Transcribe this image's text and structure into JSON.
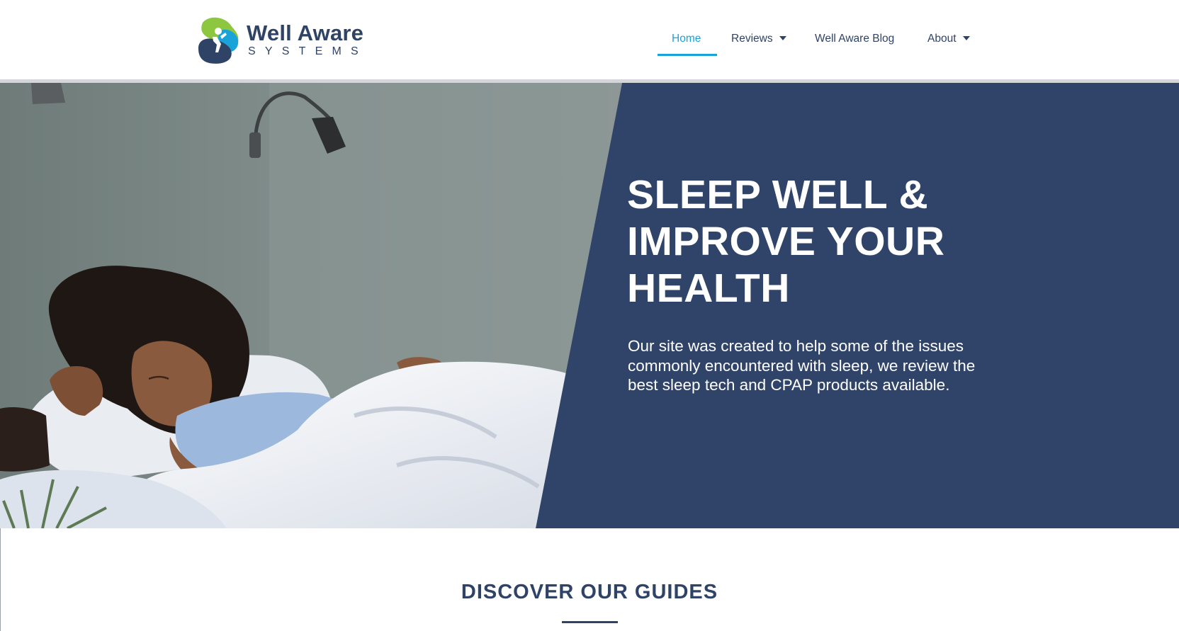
{
  "brand": {
    "name": "Well Aware",
    "tagline": "SYSTEMS",
    "colors": {
      "navy": "#30446a",
      "accent": "#1aa3d9",
      "green": "#8dc63f",
      "text": "#2f4366"
    }
  },
  "nav": {
    "items": [
      {
        "label": "Home",
        "active": true,
        "dropdown": false
      },
      {
        "label": "Reviews",
        "active": false,
        "dropdown": true
      },
      {
        "label": "Well Aware Blog",
        "active": false,
        "dropdown": false
      },
      {
        "label": "About",
        "active": false,
        "dropdown": true
      }
    ]
  },
  "hero": {
    "title": "SLEEP WELL & IMPROVE YOUR HEALTH",
    "text": "Our site was created to help some of the issues commonly encountered with sleep, we review the best sleep tech and CPAP products available.",
    "image": "woman-sleeping-in-bed-photo"
  },
  "section": {
    "title": "DISCOVER OUR GUIDES"
  }
}
